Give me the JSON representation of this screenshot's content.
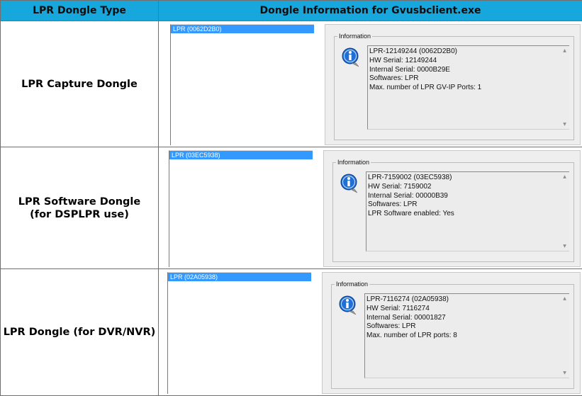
{
  "header": {
    "col1": "LPR Dongle Type",
    "col2": "Dongle Information for Gvusbclient.exe"
  },
  "rows": [
    {
      "type_lines": [
        "LPR Capture Dongle"
      ],
      "list_item": "LPR (0062D2B0)",
      "info_legend": "Information",
      "info_lines": [
        "LPR-12149244 (0062D2B0)",
        "HW Serial: 12149244",
        "Internal Serial: 0000B29E",
        "Softwares: LPR",
        "Max. number of LPR GV-IP Ports: 1"
      ]
    },
    {
      "type_lines": [
        "LPR Software Dongle",
        "(for DSPLPR use)"
      ],
      "list_item": "LPR (03EC5938)",
      "info_legend": "Information",
      "info_lines": [
        "LPR-7159002 (03EC5938)",
        "HW Serial: 7159002",
        "Internal Serial: 00000B39",
        "Softwares: LPR",
        "LPR Software enabled: Yes"
      ]
    },
    {
      "type_lines": [
        "LPR Dongle (for DVR/NVR)"
      ],
      "list_item": "LPR (02A05938)",
      "info_legend": "Information",
      "info_lines": [
        "LPR-7116274 (02A05938)",
        "HW Serial: 7116274",
        "Internal Serial: 00001827",
        "Softwares: LPR",
        "Max. number of LPR ports: 8"
      ]
    }
  ],
  "icons": {
    "info": "info-icon",
    "scroll_up": "scroll-up-arrow-icon",
    "scroll_down": "scroll-down-arrow-icon"
  },
  "colors": {
    "header_bg": "#17a7dd",
    "selection": "#3399ff",
    "icon_blue": "#1f6fd6"
  }
}
